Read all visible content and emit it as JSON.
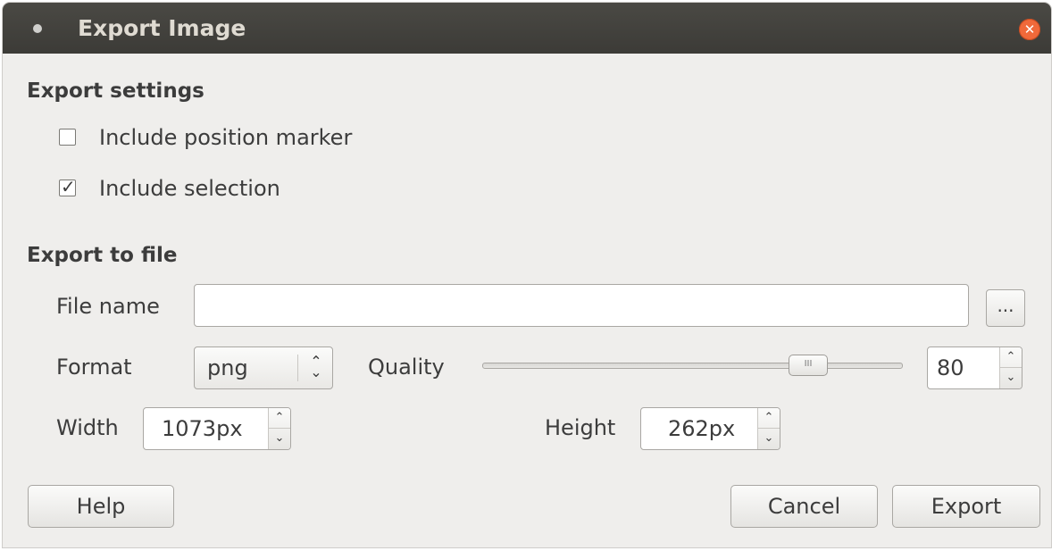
{
  "window": {
    "title": "Export Image"
  },
  "export_settings": {
    "heading": "Export settings",
    "include_position_marker": {
      "label": "Include position marker",
      "checked": false
    },
    "include_selection": {
      "label": "Include selection",
      "checked": true,
      "check_glyph": "✓"
    }
  },
  "export_to_file": {
    "heading": "Export to file",
    "file_name": {
      "label": "File name",
      "value": "",
      "browse_label": "..."
    },
    "format": {
      "label": "Format",
      "value": "png"
    },
    "quality": {
      "label": "Quality",
      "value": "80",
      "slider_percent": 80
    },
    "width": {
      "label": "Width",
      "value": "1073px"
    },
    "height": {
      "label": "Height",
      "value": "262px"
    }
  },
  "buttons": {
    "help": "Help",
    "cancel": "Cancel",
    "export": "Export"
  },
  "colors": {
    "titlebar": "#3c3b37",
    "close": "#f0693a",
    "window_bg": "#efeeec"
  }
}
